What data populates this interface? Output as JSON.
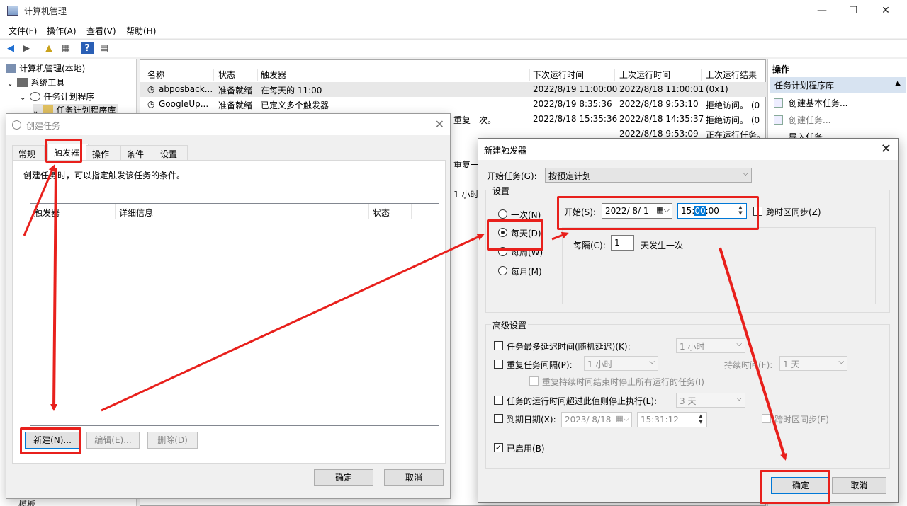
{
  "window": {
    "title": "计算机管理"
  },
  "menu": [
    "文件(F)",
    "操作(A)",
    "查看(V)",
    "帮助(H)"
  ],
  "tree": {
    "root": "计算机管理(本地)",
    "tools": "系统工具",
    "scheduler": "任务计划程序",
    "library": "任务计划程序库",
    "bottom": "模板"
  },
  "task_list": {
    "columns": [
      "名称",
      "状态",
      "触发器",
      "下次运行时间",
      "上次运行时间",
      "上次运行结果"
    ],
    "rows": [
      [
        "abposback...",
        "准备就绪",
        "在每天的 11:00",
        "2022/8/19 11:00:00",
        "2022/8/18 11:00:01",
        "(0x1)"
      ],
      [
        "GoogleUp...",
        "准备就绪",
        "已定义多个触发器",
        "2022/8/19 8:35:36",
        "2022/8/18 9:53:10",
        "拒绝访问。 (0"
      ],
      [
        "",
        "",
        "重复一次。",
        "2022/8/18 15:35:36",
        "2022/8/18 14:35:37",
        "拒绝访问。 (0"
      ],
      [
        "",
        "",
        "",
        "",
        "2022/8/18 9:53:09",
        "正在运行任务。"
      ]
    ],
    "fragments": [
      "重复一",
      "1 小时"
    ]
  },
  "actions_pane": {
    "header": "操作",
    "section": "任务计划程序库",
    "items": [
      "创建基本任务...",
      "创建任务...",
      "导入任务..."
    ]
  },
  "create_task_dialog": {
    "title": "创建任务",
    "tabs": [
      "常规",
      "触发器",
      "操作",
      "条件",
      "设置"
    ],
    "description": "创建任务时，可以指定触发该任务的条件。",
    "table_columns": [
      "触发器",
      "详细信息",
      "状态"
    ],
    "buttons": {
      "new": "新建(N)...",
      "edit": "编辑(E)...",
      "delete": "删除(D)",
      "ok": "确定",
      "cancel": "取消"
    }
  },
  "new_trigger_dialog": {
    "title": "新建触发器",
    "begin_task_label": "开始任务(G):",
    "begin_task_value": "按预定计划",
    "settings_label": "设置",
    "schedule_options": [
      "一次(N)",
      "每天(D)",
      "每周(W)",
      "每月(M)"
    ],
    "selected_schedule": "每天(D)",
    "start_label": "开始(S):",
    "start_date": "2022/ 8/ 1",
    "start_time_prefix": "15:",
    "start_time_selected": "00",
    "start_time_suffix": ":00",
    "sync_tz_label": "跨时区同步(Z)",
    "recur_label": "每隔(C):",
    "recur_value": "1",
    "recur_unit": "天发生一次",
    "advanced_label": "高级设置",
    "delay_label": "任务最多延迟时间(随机延迟)(K):",
    "delay_value": "1 小时",
    "repeat_label": "重复任务间隔(P):",
    "repeat_value": "1 小时",
    "duration_label": "持续时间(F):",
    "duration_value": "1 天",
    "stop_repeat_label": "重复持续时间结束时停止所有运行的任务(I)",
    "stop_long_label": "任务的运行时间超过此值则停止执行(L):",
    "stop_long_value": "3 天",
    "expire_label": "到期日期(X):",
    "expire_date": "2023/ 8/18",
    "expire_time": "15:31:12",
    "expire_sync_label": "跨时区同步(E)",
    "enabled_label": "已启用(B)",
    "enabled": true,
    "ok": "确定",
    "cancel": "取消"
  },
  "annotation_color": "#e8201c"
}
